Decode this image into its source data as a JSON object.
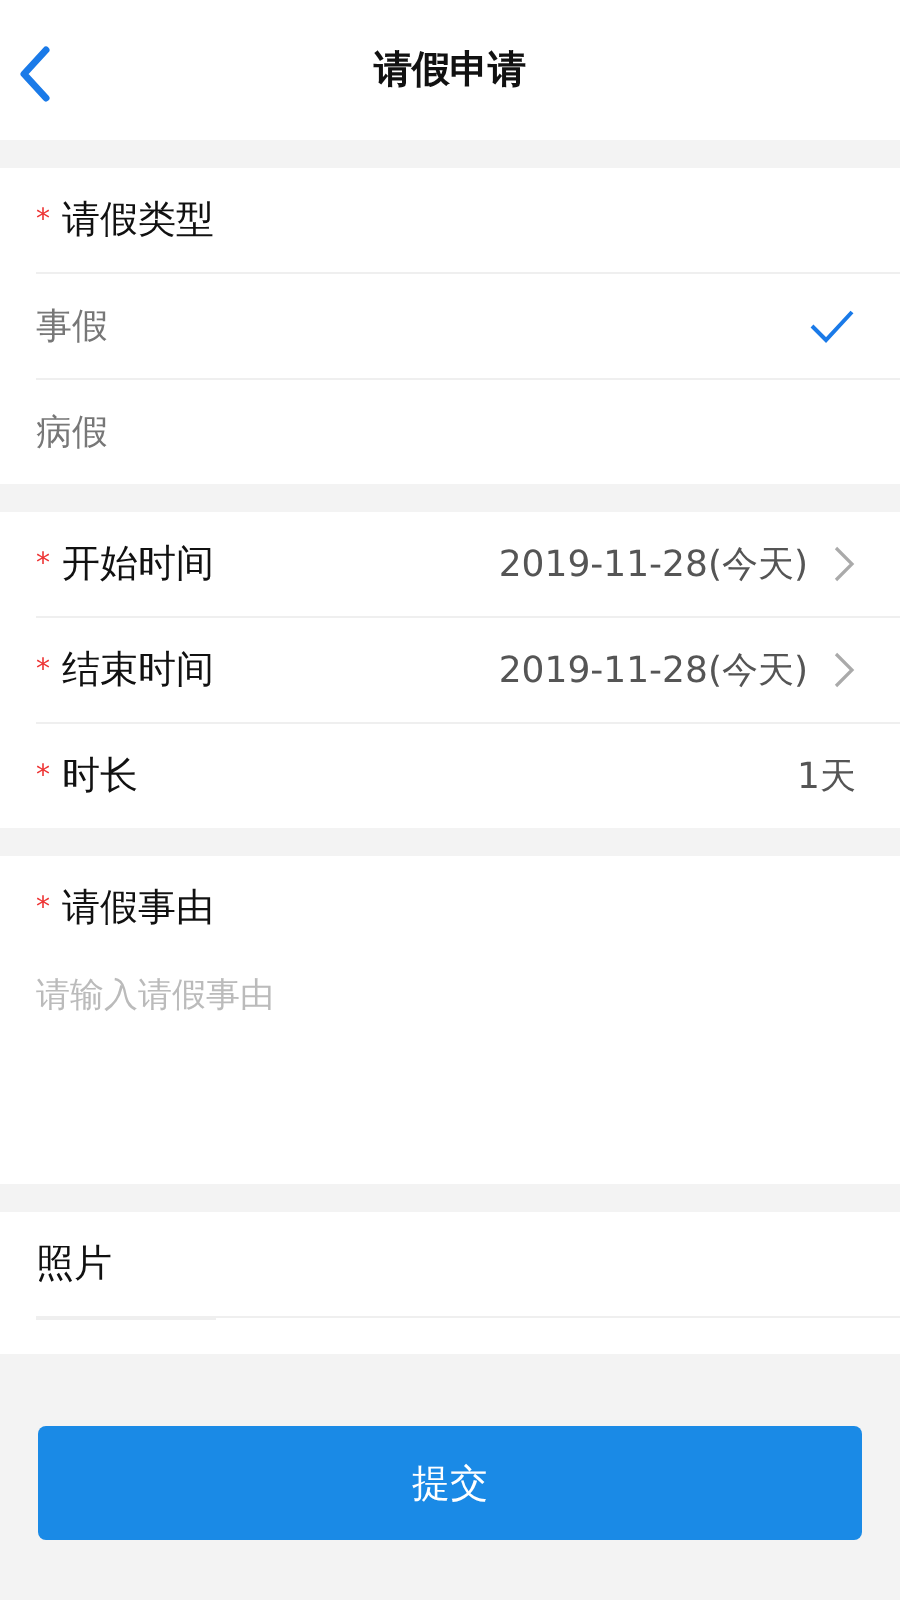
{
  "header": {
    "title": "请假申请"
  },
  "leave_type": {
    "mark": "*",
    "label": "请假类型",
    "options": [
      {
        "label": "事假",
        "selected": true
      },
      {
        "label": "病假",
        "selected": false
      }
    ]
  },
  "time_fields": [
    {
      "mark": "*",
      "label": "开始时间",
      "value": "2019-11-28(今天)",
      "kind": "picker"
    },
    {
      "mark": "*",
      "label": "结束时间",
      "value": "2019-11-28(今天)",
      "kind": "picker"
    },
    {
      "mark": "*",
      "label": "时长",
      "value": "1天",
      "kind": "static"
    }
  ],
  "reason": {
    "mark": "*",
    "label": "请假事由",
    "placeholder": "请输入请假事由"
  },
  "photo": {
    "label": "照片"
  },
  "submit": "提交"
}
